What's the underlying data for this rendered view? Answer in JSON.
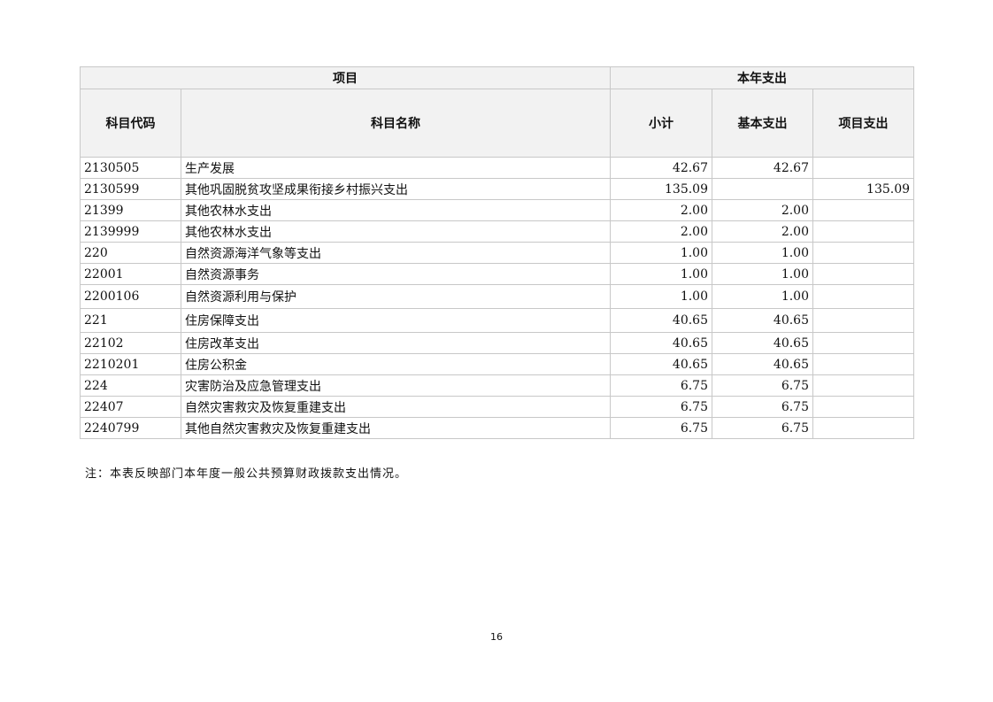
{
  "table": {
    "header_group_item": "项目",
    "header_group_expense": "本年支出",
    "col_code": "科目代码",
    "col_name": "科目名称",
    "col_subtotal": "小计",
    "col_basic": "基本支出",
    "col_project": "项目支出",
    "rows": [
      {
        "code": "2130505",
        "name": "生产发展",
        "subtotal": "42.67",
        "basic": "42.67",
        "project": ""
      },
      {
        "code": "2130599",
        "name": "其他巩固脱贫攻坚成果衔接乡村振兴支出",
        "subtotal": "135.09",
        "basic": "",
        "project": "135.09"
      },
      {
        "code": "21399",
        "name": "其他农林水支出",
        "subtotal": "2.00",
        "basic": "2.00",
        "project": ""
      },
      {
        "code": "2139999",
        "name": "其他农林水支出",
        "subtotal": "2.00",
        "basic": "2.00",
        "project": ""
      },
      {
        "code": "220",
        "name": "自然资源海洋气象等支出",
        "subtotal": "1.00",
        "basic": "1.00",
        "project": ""
      },
      {
        "code": "22001",
        "name": "自然资源事务",
        "subtotal": "1.00",
        "basic": "1.00",
        "project": ""
      },
      {
        "code": "2200106",
        "name": "自然资源利用与保护",
        "subtotal": "1.00",
        "basic": "1.00",
        "project": ""
      },
      {
        "code": "221",
        "name": "住房保障支出",
        "subtotal": "40.65",
        "basic": "40.65",
        "project": ""
      },
      {
        "code": "22102",
        "name": "住房改革支出",
        "subtotal": "40.65",
        "basic": "40.65",
        "project": ""
      },
      {
        "code": "2210201",
        "name": "住房公积金",
        "subtotal": "40.65",
        "basic": "40.65",
        "project": ""
      },
      {
        "code": "224",
        "name": "灾害防治及应急管理支出",
        "subtotal": "6.75",
        "basic": "6.75",
        "project": ""
      },
      {
        "code": "22407",
        "name": "自然灾害救灾及恢复重建支出",
        "subtotal": "6.75",
        "basic": "6.75",
        "project": ""
      },
      {
        "code": "2240799",
        "name": "其他自然灾害救灾及恢复重建支出",
        "subtotal": "6.75",
        "basic": "6.75",
        "project": ""
      }
    ]
  },
  "note": "注：本表反映部门本年度一般公共预算财政拨款支出情况。",
  "page_number": "16"
}
